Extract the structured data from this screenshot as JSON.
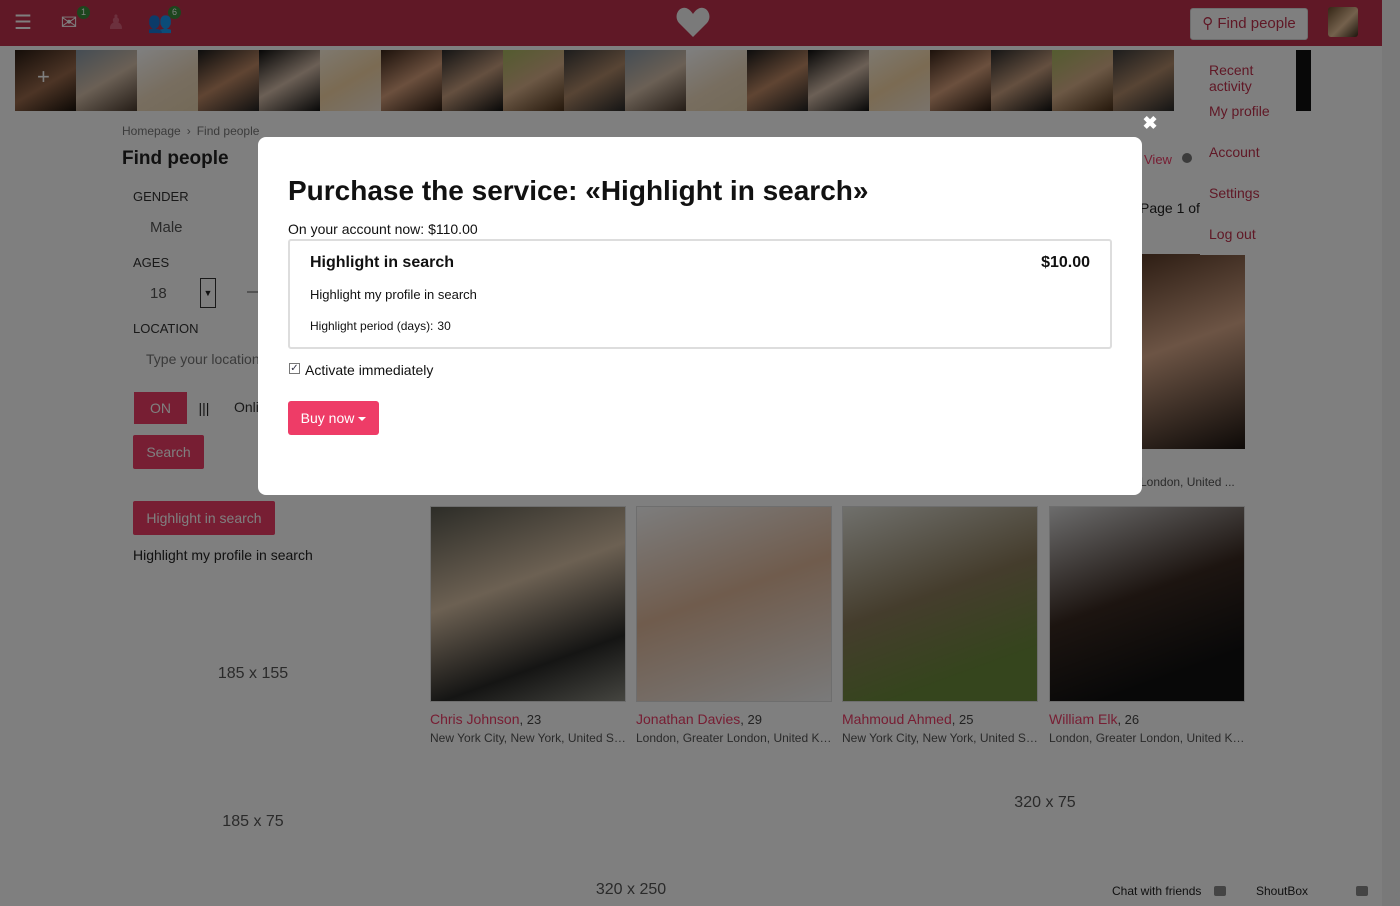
{
  "topbar": {
    "messages_count": "1",
    "friends_count": "6",
    "find_people_label": "Find people"
  },
  "menu": {
    "items": [
      "Recent activity",
      "My profile",
      "Account",
      "Settings",
      "Log out"
    ]
  },
  "breadcrumb": {
    "home": "Homepage",
    "sep": "›",
    "current": "Find people"
  },
  "left": {
    "title": "Find people",
    "gender_label": "GENDER",
    "gender_value": "Male",
    "ages_label": "AGES",
    "age_from": "18",
    "age_dash": "—",
    "location_label": "LOCATION",
    "location_placeholder": "Type your location",
    "on_label": "ON",
    "off_label": "|||",
    "online_label": "Online",
    "search_label": "Search",
    "highlight_button": "Highlight in search",
    "highlight_text": "Highlight my profile in search",
    "ad1": "185 x 155",
    "ad2": "185 x 75"
  },
  "results": {
    "view_label": "View",
    "page_label": "Page 1 of",
    "top_card_location": "London, United ...",
    "cards": [
      {
        "name": "Chris Johnson",
        "age": ", 23",
        "location": "New York City, New York, United States"
      },
      {
        "name": "Jonathan Davies",
        "age": ", 29",
        "location": "London, Greater London, United Kingdom"
      },
      {
        "name": "Mahmoud Ahmed",
        "age": ", 25",
        "location": "New York City, New York, United States"
      },
      {
        "name": "William Elk",
        "age": ", 26",
        "location": "London, Greater London, United Kingdom"
      }
    ],
    "ad_right": "320 x 75",
    "ad_bottom": "320 x 250"
  },
  "footer": {
    "chat": "Chat with friends",
    "shoutbox": "ShoutBox"
  },
  "modal": {
    "close": "✖",
    "title": "Purchase the service:  «Highlight in search»",
    "account": "On your account now: $110.00",
    "service_name": "Highlight in search",
    "service_price": "$10.00",
    "service_desc": "Highlight my profile in search",
    "period_label": "Highlight period (days):",
    "period_value": "30",
    "activate_label": "Activate immediately",
    "buy_label": "Buy now"
  },
  "colors": {
    "brand": "#c0314d",
    "accent": "#ee3c67"
  }
}
